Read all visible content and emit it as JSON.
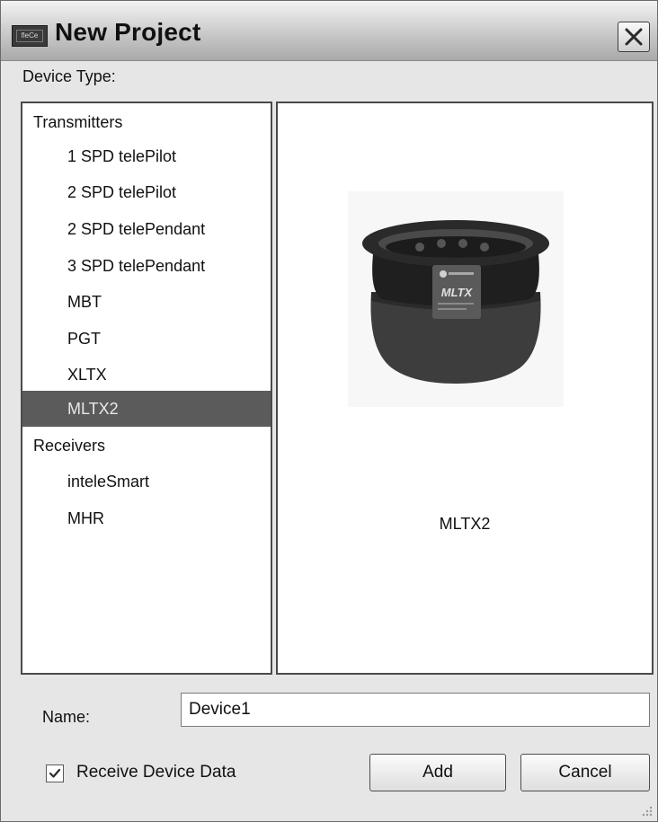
{
  "window": {
    "title": "New Project",
    "app_icon_text": "fleCe"
  },
  "device_type_label": "Device Type:",
  "device_list": {
    "groups": [
      {
        "label": "Transmitters",
        "items": [
          "1 SPD telePilot",
          "2 SPD telePilot",
          "2 SPD telePendant",
          "3 SPD telePendant",
          "MBT",
          "PGT",
          "XLTX",
          "MLTX2"
        ]
      },
      {
        "label": "Receivers",
        "items": [
          "inteleSmart",
          "MHR"
        ]
      }
    ],
    "selected": "MLTX2"
  },
  "preview": {
    "label": "MLTX2",
    "image_text": "MLTX",
    "image_icon": "device-remote-image"
  },
  "form": {
    "name_label": "Name:",
    "name_value": "Device1",
    "receive_label": "Receive Device Data",
    "receive_checked": true
  },
  "buttons": {
    "add": "Add",
    "cancel": "Cancel"
  },
  "colors": {
    "selection": "#5b5b5b",
    "dialog_bg": "#e6e6e6"
  }
}
